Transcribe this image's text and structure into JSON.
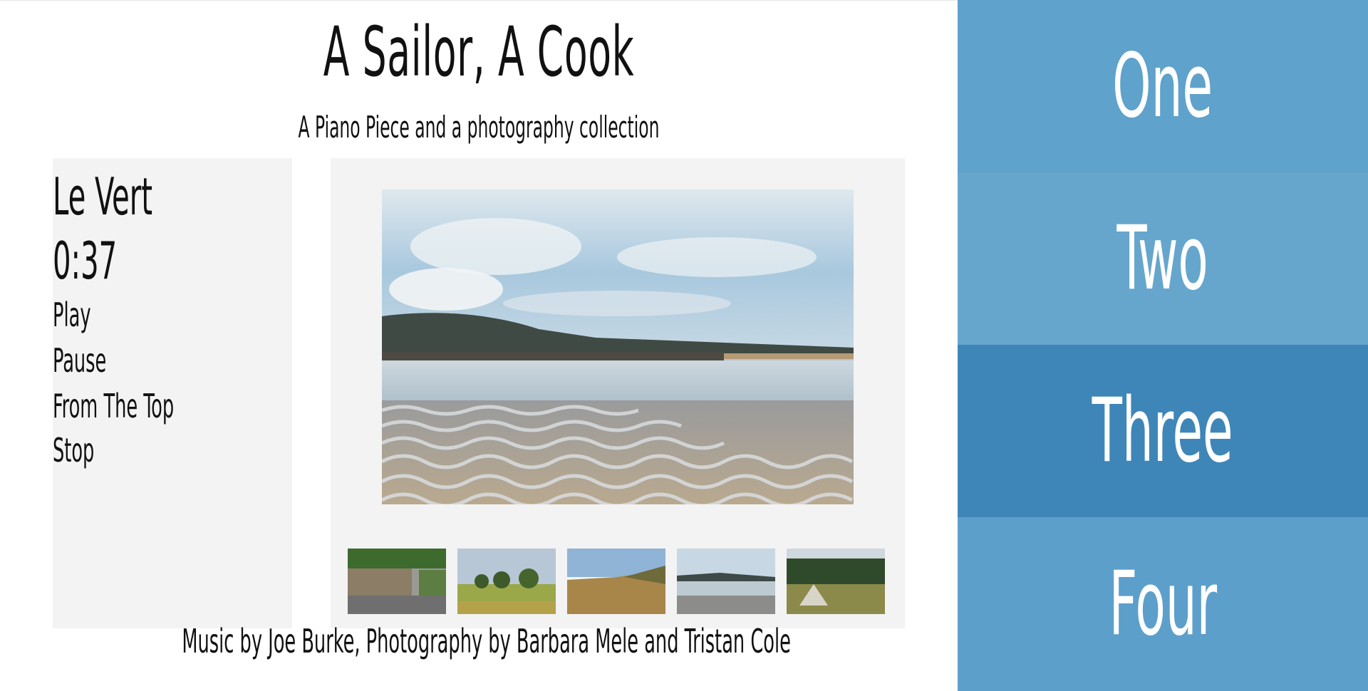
{
  "header": {
    "title": "A Sailor, A Cook",
    "subtitle": "A Piano Piece and a photography collection"
  },
  "player": {
    "track_title": "Le Vert",
    "time": "0:37",
    "controls": {
      "play": "Play",
      "pause": "Pause",
      "from_top": "From The Top",
      "stop": "Stop"
    }
  },
  "gallery": {
    "main_photo_icon": "beach-ripples-photo",
    "thumbnails": [
      {
        "icon": "wall-road-photo"
      },
      {
        "icon": "field-trees-photo"
      },
      {
        "icon": "moorland-photo"
      },
      {
        "icon": "beach-photo"
      },
      {
        "icon": "tent-field-photo"
      }
    ]
  },
  "nav": {
    "items": [
      {
        "label": "One",
        "color": "#5fa2cb"
      },
      {
        "label": "Two",
        "color": "#66a6cd"
      },
      {
        "label": "Three",
        "color": "#3f86b8"
      },
      {
        "label": "Four",
        "color": "#5d9fcb"
      }
    ]
  },
  "footer": {
    "credits": "Music by Joe Burke, Photography by Barbara Mele and Tristan Cole"
  }
}
